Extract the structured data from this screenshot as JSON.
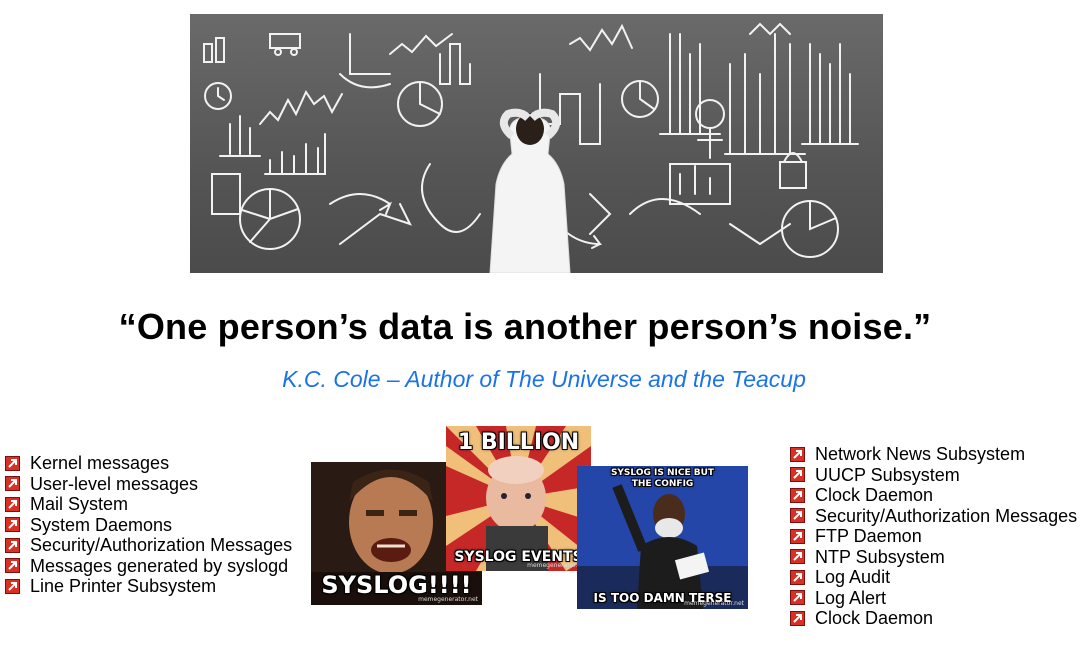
{
  "quote": "“One person’s data is another person’s noise.”",
  "attribution": "K.C. Cole – Author of The Universe and the Teacup",
  "left_list": [
    "Kernel messages",
    "User-level messages",
    "Mail System",
    "System Daemons",
    "Security/Authorization Messages",
    "Messages generated by syslogd",
    "Line Printer Subsystem"
  ],
  "right_list": [
    "Network News Subsystem",
    "UUCP Subsystem",
    "Clock Daemon",
    "Security/Authorization Messages",
    "FTP Daemon",
    "NTP Subsystem",
    "Log Audit",
    "Log Alert",
    "Clock Daemon"
  ],
  "memes": {
    "khan": {
      "caption": "SYSLOG!!!!",
      "watermark": "memegenerator.net"
    },
    "evil": {
      "top": "1 BILLION",
      "bottom": "SYSLOG EVENTS",
      "watermark": "memegenerator.net"
    },
    "jimmy": {
      "top": "SYSLOG IS NICE BUT THE CONFIG",
      "bottom": "IS TOO DAMN TERSE",
      "watermark": "memegenerator.net"
    }
  },
  "colors": {
    "attribution": "#1a73e8",
    "bullet": "#d93025"
  },
  "icons": {
    "bullet": "red-arrow-bullet-icon"
  }
}
